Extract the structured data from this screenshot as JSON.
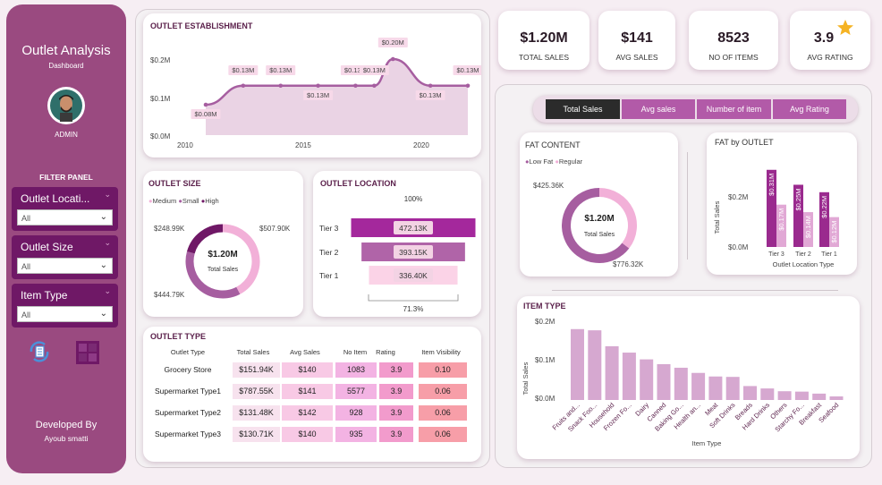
{
  "sidebar": {
    "title": "Outlet Analysis",
    "subtitle": "Dashboard",
    "user": "ADMIN",
    "filter_panel": "FILTER PANEL",
    "filters": [
      {
        "label": "Outlet Locati...",
        "value": "All"
      },
      {
        "label": "Outlet Size",
        "value": "All"
      },
      {
        "label": "Item Type",
        "value": "All"
      }
    ],
    "developed_by": "Developed By",
    "author": "Ayoub smatti"
  },
  "kpis": [
    {
      "value": "$1.20M",
      "label": "TOTAL SALES"
    },
    {
      "value": "$141",
      "label": "AVG SALES"
    },
    {
      "value": "8523",
      "label": "NO OF ITEMS"
    },
    {
      "value": "3.9",
      "label": "AVG RATING"
    }
  ],
  "tabs": [
    "Total Sales",
    "Avg sales",
    "Number of item",
    "Avg Rating"
  ],
  "establishment": {
    "title": "OUTLET ESTABLISHMENT",
    "yticks": [
      "$0.2M",
      "$0.1M",
      "$0.0M"
    ],
    "xticks": [
      "2010",
      "2015",
      "2020"
    ],
    "labels": [
      "$0.08M",
      "$0.13M",
      "$0.13M",
      "$0.13M",
      "$0.13M",
      "$0.13M",
      "$0.20M",
      "$0.13M",
      "$0.13M"
    ]
  },
  "outlet_size": {
    "title": "OUTLET SIZE",
    "legend": [
      "Medium",
      "Small",
      "High"
    ],
    "center_value": "$1.20M",
    "center_label": "Total Sales",
    "labels": [
      "$248.99K",
      "$507.90K",
      "$444.79K"
    ]
  },
  "outlet_location": {
    "title": "OUTLET LOCATION",
    "top_pct": "100%",
    "bottom_pct": "71.3%",
    "tiers": [
      "Tier 3",
      "Tier 2",
      "Tier 1"
    ],
    "values": [
      "472.13K",
      "393.15K",
      "336.40K"
    ]
  },
  "outlet_type": {
    "title": "OUTLET TYPE",
    "headers": [
      "Outlet Type",
      "Total Sales",
      "Avg Sales",
      "No Item",
      "Rating",
      "Item Visibility"
    ],
    "rows": [
      [
        "Grocery Store",
        "$151.94K",
        "$140",
        "1083",
        "3.9",
        "0.10"
      ],
      [
        "Supermarket Type1",
        "$787.55K",
        "$141",
        "5577",
        "3.9",
        "0.06"
      ],
      [
        "Supermarket Type2",
        "$131.48K",
        "$142",
        "928",
        "3.9",
        "0.06"
      ],
      [
        "Supermarket Type3",
        "$130.71K",
        "$140",
        "935",
        "3.9",
        "0.06"
      ]
    ]
  },
  "fat_content": {
    "title": "FAT CONTENT",
    "legend": [
      "Low Fat",
      "Regular"
    ],
    "center_value": "$1.20M",
    "center_label": "Total Sales",
    "labels": [
      "$425.36K",
      "$776.32K"
    ]
  },
  "fat_by_outlet": {
    "title": "FAT by OUTLET",
    "ylabel": "Total Sales",
    "xlabel": "Outlet Location Type",
    "yticks": [
      "$0.2M",
      "$0.0M"
    ]
  },
  "item_type": {
    "title": "ITEM TYPE",
    "ylabel": "Total Sales",
    "xlabel": "Item Type",
    "yticks": [
      "$0.2M",
      "$0.1M",
      "$0.0M"
    ]
  },
  "colors": {
    "sidebar": "#9a4a80",
    "accent": "#b25aa8",
    "dark": "#6f1866",
    "light": "#f2c6e4"
  },
  "chart_data": [
    {
      "type": "area",
      "title": "OUTLET ESTABLISHMENT",
      "x": [
        2009,
        2011,
        2013,
        2015,
        2017,
        2018,
        2019,
        2021,
        2023
      ],
      "values": [
        0.08,
        0.13,
        0.13,
        0.13,
        0.13,
        0.13,
        0.2,
        0.13,
        0.13
      ],
      "ylim": [
        0,
        0.2
      ]
    },
    {
      "type": "pie",
      "title": "OUTLET SIZE",
      "categories": [
        "Medium",
        "Small",
        "High"
      ],
      "values": [
        507.9,
        444.79,
        248.99
      ]
    },
    {
      "type": "bar",
      "title": "OUTLET LOCATION",
      "categories": [
        "Tier 3",
        "Tier 2",
        "Tier 1"
      ],
      "values": [
        472.13,
        393.15,
        336.4
      ]
    },
    {
      "type": "pie",
      "title": "FAT CONTENT",
      "categories": [
        "Low Fat",
        "Regular"
      ],
      "values": [
        776.32,
        425.36
      ]
    },
    {
      "type": "bar",
      "title": "FAT by OUTLET",
      "categories": [
        "Tier 3",
        "Tier 2",
        "Tier 1"
      ],
      "series": [
        {
          "name": "Low Fat",
          "values": [
            0.31,
            0.25,
            0.22
          ],
          "labels": [
            "$0.31M",
            "$0.25M",
            "$0.22M"
          ]
        },
        {
          "name": "Regular",
          "values": [
            0.17,
            0.14,
            0.12
          ],
          "labels": [
            "$0.17M",
            "$0.14M",
            "$0.12M"
          ]
        }
      ],
      "ylim": [
        0,
        0.32
      ]
    },
    {
      "type": "bar",
      "title": "ITEM TYPE",
      "categories": [
        "Fruits and...",
        "Snack Foo...",
        "Household",
        "Frozen Fo...",
        "Dairy",
        "Canned",
        "Baking Go...",
        "Health an...",
        "Meat",
        "Soft Drinks",
        "Breads",
        "Hard Drinks",
        "Others",
        "Starchy Fo...",
        "Breakfast",
        "Seafood"
      ],
      "values": [
        0.178,
        0.175,
        0.135,
        0.119,
        0.102,
        0.09,
        0.081,
        0.068,
        0.059,
        0.058,
        0.035,
        0.029,
        0.022,
        0.021,
        0.016,
        0.009
      ],
      "ylim": [
        0,
        0.2
      ]
    }
  ]
}
